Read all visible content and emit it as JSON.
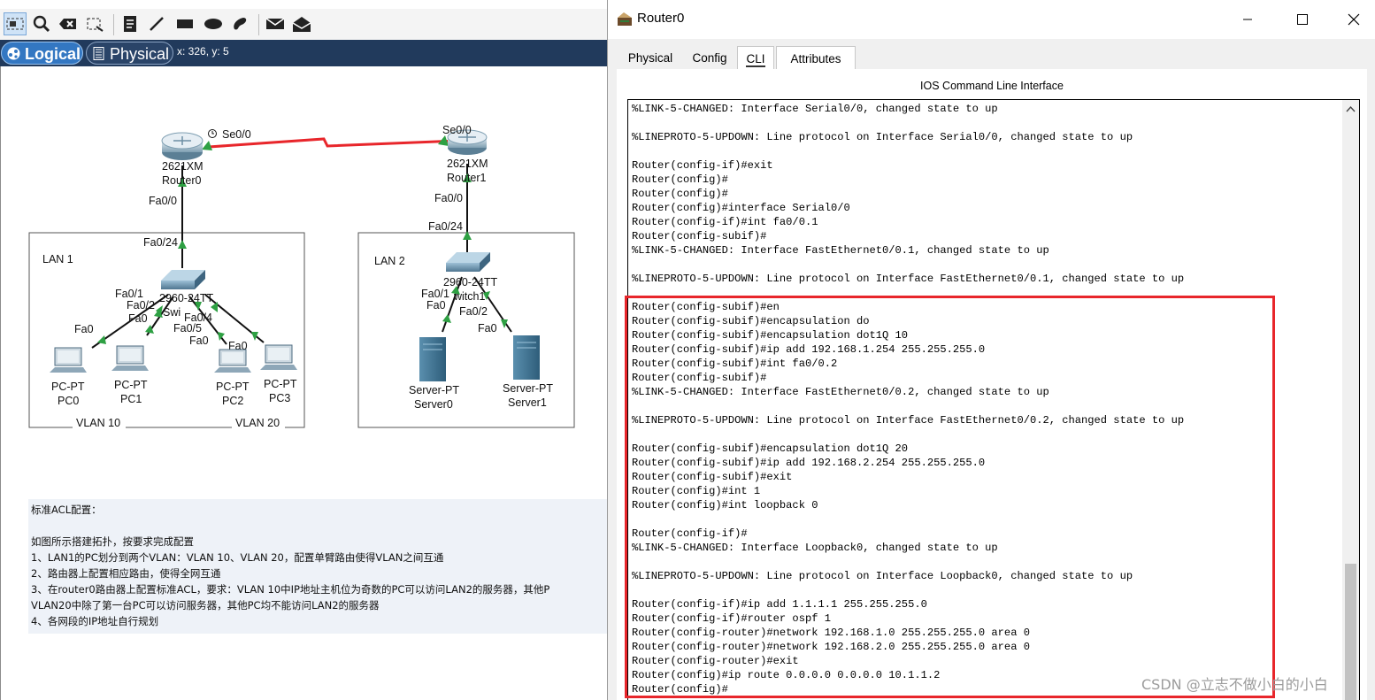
{
  "workspace": {
    "view_tabs": {
      "logical": "Logical",
      "physical": "Physical"
    },
    "coordinates": "x: 326, y: 5",
    "topology": {
      "router0": {
        "model": "2621XM",
        "name": "Router0",
        "serial_port": "Se0/0",
        "fa_port": "Fa0/0"
      },
      "router1": {
        "model": "2621XM",
        "name": "Router1",
        "serial_port": "Se0/0",
        "fa_port": "Fa0/0"
      },
      "lan1": {
        "label": "LAN 1",
        "switch_model": "2960-24TT",
        "switch_name": "Switch0",
        "switch_name_visible": "Swi",
        "uplink_port": "Fa0/24",
        "switch_ports": [
          "Fa0/1",
          "Fa0/2",
          "Fa0/3",
          "Fa0/4"
        ],
        "switch_ports_visible": [
          "Fa0/1",
          "Fa0/2",
          "Fa0/5",
          "Fa0/4"
        ],
        "pc_port": "Fa0",
        "pcs": [
          {
            "type": "PC-PT",
            "name": "PC0"
          },
          {
            "type": "PC-PT",
            "name": "PC1"
          },
          {
            "type": "PC-PT",
            "name": "PC2"
          },
          {
            "type": "PC-PT",
            "name": "PC3"
          }
        ],
        "vlans": [
          "VLAN 10",
          "VLAN 20"
        ]
      },
      "lan2": {
        "label": "LAN 2",
        "switch_model": "2960-24TT",
        "switch_name": "Switch1",
        "switch_name_visible": "witch1",
        "uplink_port": "Fa0/24",
        "switch_ports": [
          "Fa0/1",
          "Fa0/2"
        ],
        "server_port": "Fa0",
        "servers": [
          {
            "type": "Server-PT",
            "name": "Server0"
          },
          {
            "type": "Server-PT",
            "name": "Server1"
          }
        ]
      }
    },
    "notes": [
      "标准ACL配置：",
      "",
      "如图所示搭建拓扑，按要求完成配置",
      "1、LAN1的PC划分到两个VLAN：VLAN 10、VLAN 20，配置单臂路由使得VLAN之间互通",
      "2、路由器上配置相应路由，使得全网互通",
      "3、在router0路由器上配置标准ACL，要求：VLAN 10中IP地址主机位为奇数的PC可以访问LAN2的服务器，其他P",
      "VLAN20中除了第一台PC可以访问服务器，其他PC均不能访问LAN2的服务器",
      "4、各网段的IP地址自行规划"
    ]
  },
  "router_window": {
    "title": "Router0",
    "tabs": [
      "Physical",
      "Config",
      "CLI",
      "Attributes"
    ],
    "active_tab": "CLI",
    "cli_header": "IOS Command Line Interface",
    "cli_lines": [
      "%LINK-5-CHANGED: Interface Serial0/0, changed state to up",
      "",
      "%LINEPROTO-5-UPDOWN: Line protocol on Interface Serial0/0, changed state to up",
      "",
      "Router(config-if)#exit",
      "Router(config)#",
      "Router(config)#",
      "Router(config)#interface Serial0/0",
      "Router(config-if)#int fa0/0.1",
      "Router(config-subif)#",
      "%LINK-5-CHANGED: Interface FastEthernet0/0.1, changed state to up",
      "",
      "%LINEPROTO-5-UPDOWN: Line protocol on Interface FastEthernet0/0.1, changed state to up",
      "",
      "Router(config-subif)#en",
      "Router(config-subif)#encapsulation do",
      "Router(config-subif)#encapsulation dot1Q 10",
      "Router(config-subif)#ip add 192.168.1.254 255.255.255.0",
      "Router(config-subif)#int fa0/0.2",
      "Router(config-subif)#",
      "%LINK-5-CHANGED: Interface FastEthernet0/0.2, changed state to up",
      "",
      "%LINEPROTO-5-UPDOWN: Line protocol on Interface FastEthernet0/0.2, changed state to up",
      "",
      "Router(config-subif)#encapsulation dot1Q 20",
      "Router(config-subif)#ip add 192.168.2.254 255.255.255.0",
      "Router(config-subif)#exit",
      "Router(config)#int 1",
      "Router(config)#int loopback 0",
      "",
      "Router(config-if)#",
      "%LINK-5-CHANGED: Interface Loopback0, changed state to up",
      "",
      "%LINEPROTO-5-UPDOWN: Line protocol on Interface Loopback0, changed state to up",
      "",
      "Router(config-if)#ip add 1.1.1.1 255.255.255.0",
      "Router(config-if)#router ospf 1",
      "Router(config-router)#network 192.168.1.0 255.255.255.0 area 0",
      "Router(config-router)#network 192.168.2.0 255.255.255.0 area 0",
      "Router(config-router)#exit",
      "Router(config)#ip route 0.0.0.0 0.0.0.0 10.1.1.2",
      "Router(config)#"
    ]
  },
  "watermark": "CSDN @立志不做小白的小白",
  "colors": {
    "highlight_box": "#e8262b",
    "serial_link": "#e8262b",
    "link_up": "#2ea043",
    "view_bar": "#213a5c"
  }
}
